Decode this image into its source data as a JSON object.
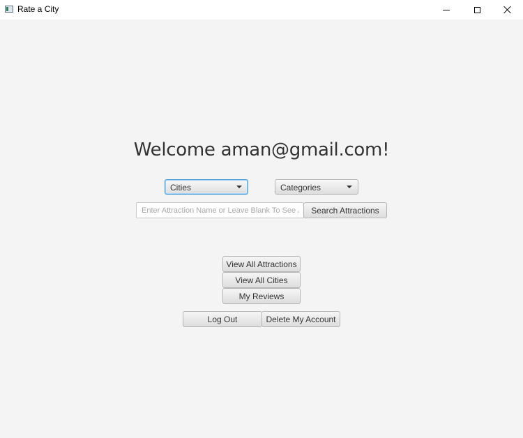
{
  "window": {
    "title": "Rate a City"
  },
  "main": {
    "welcome": "Welcome aman@gmail.com!",
    "cities_combo": {
      "selected": "Cities"
    },
    "categories_combo": {
      "selected": "Categories"
    },
    "search": {
      "placeholder": "Enter Attraction Name or Leave Blank To See All",
      "value": "",
      "button_label": "Search Attractions"
    },
    "buttons": {
      "view_all_attractions": "View All Attractions",
      "view_all_cities": "View All Cities",
      "my_reviews": "My Reviews",
      "log_out": "Log Out",
      "delete_account": "Delete My Account"
    }
  },
  "colors": {
    "background": "#f4f4f4",
    "focus_border": "#3c9ad8",
    "text": "#333333"
  }
}
